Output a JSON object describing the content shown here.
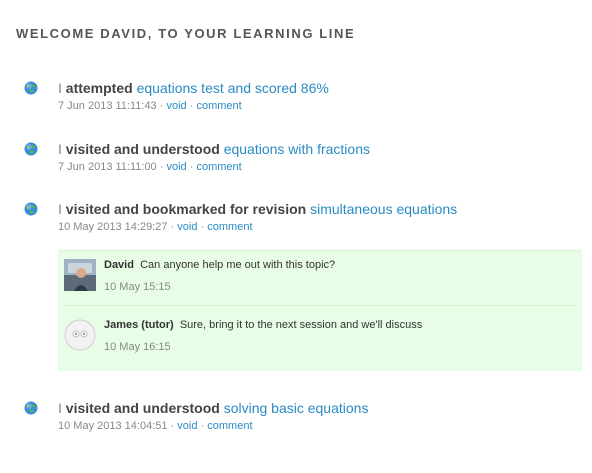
{
  "page": {
    "title": "WELCOME DAVID, TO YOUR LEARNING LINE"
  },
  "entries": [
    {
      "pronoun": "I",
      "verb": "attempted",
      "target": "equations test and scored 86%",
      "timestamp": "7 Jun 2013 11:11:43",
      "void": "void",
      "comment": "comment"
    },
    {
      "pronoun": "I",
      "verb": "visited and understood",
      "target": "equations with fractions",
      "timestamp": "7 Jun 2013 11:11:00",
      "void": "void",
      "comment": "comment"
    },
    {
      "pronoun": "I",
      "verb": "visited and bookmarked for revision",
      "target": "simultaneous equations",
      "timestamp": "10 May 2013 14:29:27",
      "void": "void",
      "comment": "comment"
    },
    {
      "pronoun": "I",
      "verb": "visited and understood",
      "target": "solving basic equations",
      "timestamp": "10 May 2013 14:04:51",
      "void": "void",
      "comment": "comment"
    }
  ],
  "separator": "·",
  "comments": [
    {
      "author": "David",
      "text": "Can anyone help me out with this topic?",
      "time": "10 May 15:15"
    },
    {
      "author": "James (tutor)",
      "text": "Sure, bring it to the next session and we'll discuss",
      "time": "10 May 16:15"
    }
  ],
  "colors": {
    "link": "#2a8bc4",
    "comment_bg": "#e8fde6",
    "muted": "#888888"
  }
}
